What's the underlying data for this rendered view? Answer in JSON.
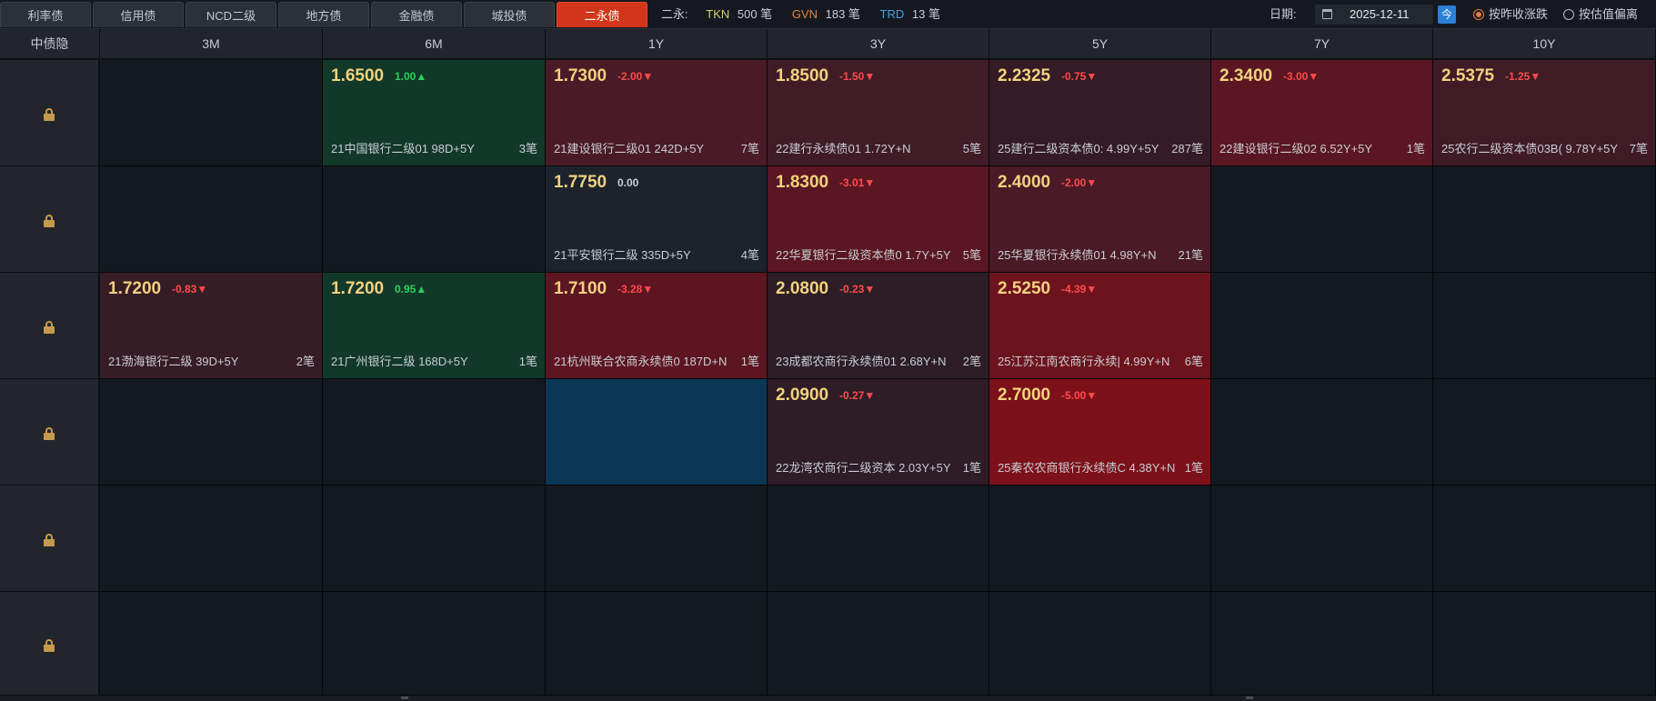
{
  "tabs": [
    "利率债",
    "信用债",
    "NCD二级",
    "地方债",
    "金融债",
    "城投债",
    "二永债"
  ],
  "active_tab": "二永债",
  "summary": {
    "label": "二永:",
    "tkn_label": "TKN",
    "tkn_count": "500 笔",
    "gvn_label": "GVN",
    "gvn_count": "183 笔",
    "trd_label": "TRD",
    "trd_count": "13 笔"
  },
  "date": {
    "label": "日期:",
    "value": "2025-12-11",
    "today_button": "今"
  },
  "sort_options": {
    "option1": "按昨收涨跌",
    "option2": "按估值偏离",
    "selected": "按昨收涨跌"
  },
  "grid": {
    "corner_label": "中债隐",
    "columns": [
      "3M",
      "6M",
      "1Y",
      "3Y",
      "5Y",
      "7Y",
      "10Y"
    ],
    "row_count": 6
  },
  "colors": {
    "green_cell": "#12382a",
    "red_dark": "#3b1b24",
    "red_mid": "#4f1922",
    "red_bright": "#6b1420",
    "red_strong": "#7c1119",
    "blue_cell": "#0b3757",
    "neutral_cell": "#1c232c",
    "up": "#2bd05a",
    "down": "#ff4b4b",
    "tkn": "#d8cf6a",
    "gvn": "#e4883a",
    "trd": "#4a9fe0"
  },
  "cells": [
    {
      "row": 0,
      "col": 1,
      "rate": "1.6500",
      "change": "1.00▲",
      "dir": "up",
      "name": "21中国银行二级01 98D+5Y",
      "count": "3笔",
      "bg": "#12382a"
    },
    {
      "row": 0,
      "col": 2,
      "rate": "1.7300",
      "change": "-2.00▼",
      "dir": "down",
      "name": "21建设银行二级01 242D+5Y",
      "count": "7笔",
      "bg": "#4a1a26"
    },
    {
      "row": 0,
      "col": 3,
      "rate": "1.8500",
      "change": "-1.50▼",
      "dir": "down",
      "name": "22建行永续债01 1.72Y+N",
      "count": "5笔",
      "bg": "#401c27"
    },
    {
      "row": 0,
      "col": 4,
      "rate": "2.2325",
      "change": "-0.75▼",
      "dir": "down",
      "name": "25建行二级资本债0: 4.99Y+5Y",
      "count": "287笔",
      "bg": "#341b25"
    },
    {
      "row": 0,
      "col": 5,
      "rate": "2.3400",
      "change": "-3.00▼",
      "dir": "down",
      "name": "22建设银行二级02 6.52Y+5Y",
      "count": "1笔",
      "bg": "#5a1622"
    },
    {
      "row": 0,
      "col": 6,
      "rate": "2.5375",
      "change": "-1.25▼",
      "dir": "down",
      "name": "25农行二级资本债03B( 9.78Y+5Y",
      "count": "7笔",
      "bg": "#3f1b26"
    },
    {
      "row": 1,
      "col": 2,
      "rate": "1.7750",
      "change": "0.00",
      "dir": "flat",
      "name": "21平安银行二级 335D+5Y",
      "count": "4笔",
      "bg": "#1c232c"
    },
    {
      "row": 1,
      "col": 3,
      "rate": "1.8300",
      "change": "-3.01▼",
      "dir": "down",
      "name": "22华夏银行二级资本债0 1.7Y+5Y",
      "count": "5笔",
      "bg": "#5a1622"
    },
    {
      "row": 1,
      "col": 4,
      "rate": "2.4000",
      "change": "-2.00▼",
      "dir": "down",
      "name": "25华夏银行永续债01 4.98Y+N",
      "count": "21笔",
      "bg": "#4a1a26"
    },
    {
      "row": 2,
      "col": 0,
      "rate": "1.7200",
      "change": "-0.83▼",
      "dir": "down",
      "name": "21渤海银行二级 39D+5Y",
      "count": "2笔",
      "bg": "#361c25"
    },
    {
      "row": 2,
      "col": 1,
      "rate": "1.7200",
      "change": "0.95▲",
      "dir": "up",
      "name": "21广州银行二级 168D+5Y",
      "count": "1笔",
      "bg": "#12382a"
    },
    {
      "row": 2,
      "col": 2,
      "rate": "1.7100",
      "change": "-3.28▼",
      "dir": "down",
      "name": "21杭州联合农商永续债0 187D+N",
      "count": "1笔",
      "bg": "#5c1521"
    },
    {
      "row": 2,
      "col": 3,
      "rate": "2.0800",
      "change": "-0.23▼",
      "dir": "down",
      "name": "23成都农商行永续债01 2.68Y+N",
      "count": "2笔",
      "bg": "#2c1d26"
    },
    {
      "row": 2,
      "col": 4,
      "rate": "2.5250",
      "change": "-4.39▼",
      "dir": "down",
      "name": "25江苏江南农商行永续| 4.99Y+N",
      "count": "6笔",
      "bg": "#6d131d"
    },
    {
      "row": 3,
      "col": 2,
      "rate": "",
      "change": "",
      "dir": "flat",
      "name": "",
      "count": "",
      "bg": "#0b3757"
    },
    {
      "row": 3,
      "col": 3,
      "rate": "2.0900",
      "change": "-0.27▼",
      "dir": "down",
      "name": "22龙湾农商行二级资本 2.03Y+5Y",
      "count": "1笔",
      "bg": "#2e1c26"
    },
    {
      "row": 3,
      "col": 4,
      "rate": "2.7000",
      "change": "-5.00▼",
      "dir": "down",
      "name": "25秦农农商银行永续债C 4.38Y+N",
      "count": "1笔",
      "bg": "#7c1119"
    }
  ]
}
